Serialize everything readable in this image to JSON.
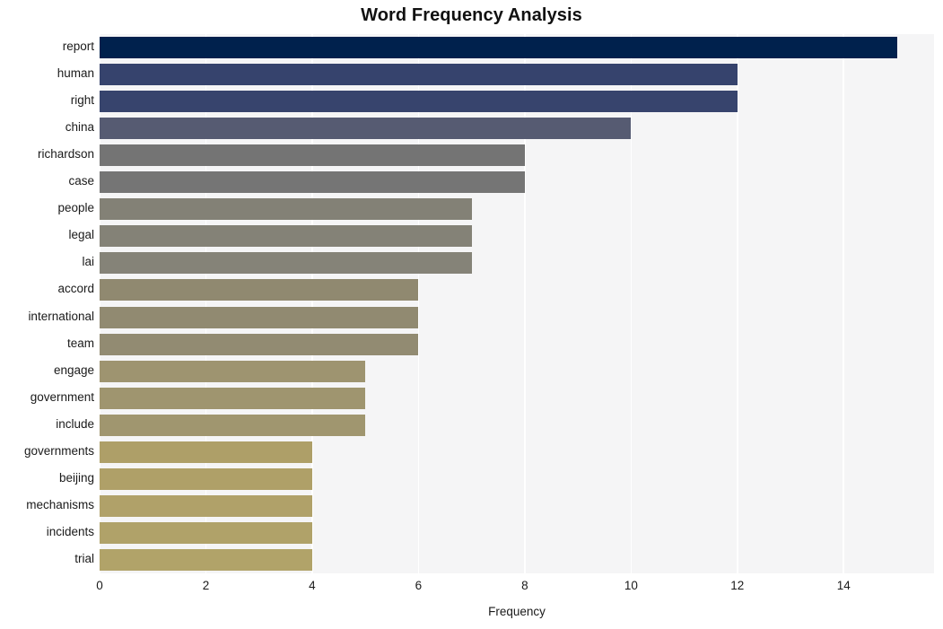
{
  "chart_data": {
    "type": "bar",
    "orientation": "horizontal",
    "title": "Word Frequency Analysis",
    "xlabel": "Frequency",
    "ylabel": "",
    "categories": [
      "report",
      "human",
      "right",
      "china",
      "richardson",
      "case",
      "people",
      "legal",
      "lai",
      "accord",
      "international",
      "team",
      "engage",
      "government",
      "include",
      "governments",
      "beijing",
      "mechanisms",
      "incidents",
      "trial"
    ],
    "values": [
      15,
      12,
      12,
      10,
      8,
      8,
      7,
      7,
      7,
      6,
      6,
      6,
      5,
      5,
      5,
      4,
      4,
      4,
      4,
      4
    ],
    "xticks": [
      0,
      2,
      4,
      6,
      8,
      10,
      12,
      14
    ],
    "xticklabels": [
      "0",
      "2",
      "4",
      "6",
      "8",
      "10",
      "12",
      "14"
    ],
    "xlim": [
      0,
      15.7
    ],
    "grid": "vertical",
    "legend": "none",
    "bar_colors": [
      "#00214d",
      "#36436d",
      "#37446d",
      "#565b72",
      "#747474",
      "#757575",
      "#838176",
      "#848277",
      "#858378",
      "#908970",
      "#918a71",
      "#928b72",
      "#9e9470",
      "#9f956f",
      "#a0966f",
      "#ae9f68",
      "#afa068",
      "#b0a169",
      "#b0a269",
      "#b1a369"
    ],
    "plot_background": "#f5f5f6",
    "grid_color": "#ffffff",
    "figure_background": "#ffffff"
  }
}
